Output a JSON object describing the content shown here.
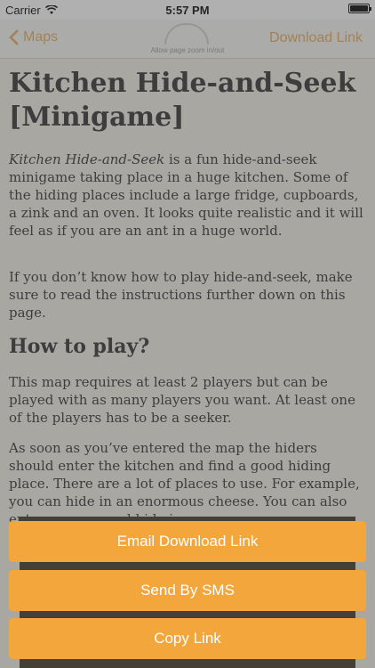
{
  "status_bar": {
    "carrier": "Carrier",
    "time": "5:57 PM",
    "battery_level": 1.0
  },
  "nav": {
    "back_label": "Maps",
    "action_label": "Download Link",
    "hint": "Allow page zoom in/out"
  },
  "article": {
    "title": "Kitchen Hide-and-Seek [Minigame]",
    "intro_italic": "Kitchen Hide-and-Seek",
    "intro_rest": " is a fun hide-and-seek minigame taking place in a huge kitchen. Some of the hiding places include a large fridge, cupboards, a zink and an oven. It looks quite realistic and it will feel as if you are an ant in a huge world.",
    "para2": "If you don’t know how to play hide-and-seek, make sure to read the instructions further down on this page.",
    "heading2": "How to play?",
    "para3": "This map requires at least 2 players but can be played with as many players you want. At least one of the players has to be a seeker.",
    "para4": "As soon as you’ve entered the map the hiders should enter the kitchen and find a good hiding place. There are a lot of places to use. For example, you can hide in an enormous cheese. You can also enter an oven and hide in"
  },
  "actions": [
    {
      "label": "Email Download Link"
    },
    {
      "label": "Send By SMS"
    },
    {
      "label": "Copy Link"
    }
  ],
  "colors": {
    "accent": "#f3a63c",
    "nav_tint": "#e8a95a"
  }
}
